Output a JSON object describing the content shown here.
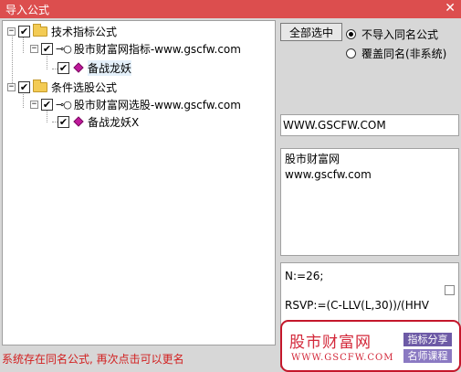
{
  "window": {
    "title": "导入公式",
    "close_glyph": "✕"
  },
  "tree": {
    "nodes": [
      {
        "label": "技术指标公式",
        "checked": true,
        "expander": "−",
        "icon": "folder-icon"
      },
      {
        "label": "股市财富网指标-www.gscfw.com",
        "checked": true,
        "expander": "−",
        "icon": "key-icon"
      },
      {
        "label": "备战龙妖",
        "checked": true,
        "icon": "gem-icon"
      },
      {
        "label": "条件选股公式",
        "checked": true,
        "expander": "−",
        "icon": "folder-icon"
      },
      {
        "label": "股市财富网选股-www.gscfw.com",
        "checked": true,
        "expander": "−",
        "icon": "key-icon"
      },
      {
        "label": "备战龙妖X",
        "checked": true,
        "icon": "gem-icon"
      }
    ],
    "key_glyph": "⊸○",
    "check_glyph": "✔"
  },
  "options": {
    "select_all_label": "全部选中",
    "radio_no_import": "不导入同名公式",
    "radio_overwrite": "覆盖同名(非系统)",
    "selected": "no_import"
  },
  "info": {
    "url": "WWW.GSCFW.COM",
    "description_line1": "股市财富网",
    "description_line2": "www.gscfw.com"
  },
  "code": {
    "line1": "N:=26;",
    "line2": "",
    "line3": "RSVP:=(C-LLV(L,30))/(HHV",
    "line4": "..."
  },
  "status": {
    "text": "系统存在同名公式, 再次点击可以更名"
  },
  "watermark": {
    "title": "股市财富网",
    "url": "WWW.GSCFW.COM",
    "tag1": "指标分享",
    "tag2": "名师课程"
  },
  "colors": {
    "titlebar": "#dc4e4e",
    "status_text": "#d21f1f",
    "watermark_red": "#d3283a",
    "tag_purple": "#6d5aa6"
  }
}
